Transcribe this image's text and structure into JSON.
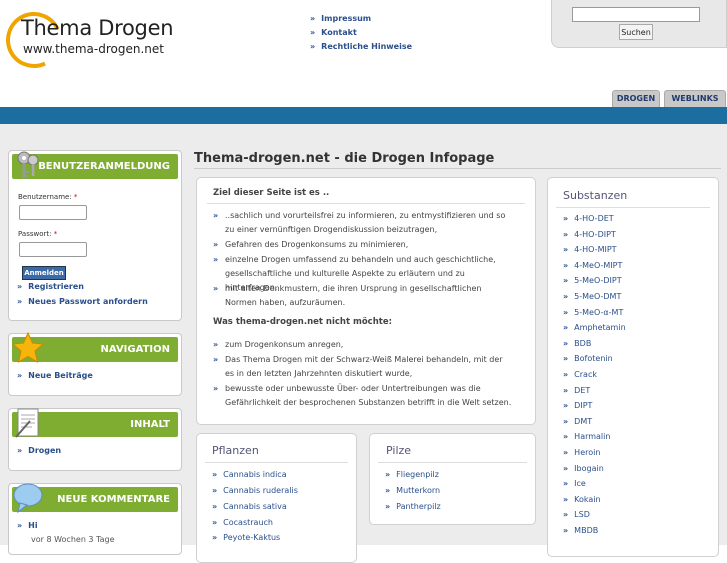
{
  "header": {
    "logo_title": "Thema Drogen",
    "logo_url": "www.thema-drogen.net",
    "top_links": [
      "Impressum",
      "Kontakt",
      "Rechtliche Hinweise"
    ],
    "search_button": "Suchen",
    "search_value": "",
    "tabs": [
      "DROGEN",
      "WEBLINKS"
    ]
  },
  "colors": {
    "accent_green": "#7fad32",
    "bar_blue": "#1c6ea0",
    "link_blue": "#2b4f8c"
  },
  "login": {
    "title": "BENUTZERANMELDUNG",
    "username_label": "Benutzername:",
    "password_label": "Passwort:",
    "required_mark": "*",
    "submit": "Anmelden",
    "register": "Registrieren",
    "forgot": "Neues Passwort anfordern"
  },
  "navigation": {
    "title": "NAVIGATION",
    "items": [
      "Neue Beiträge"
    ]
  },
  "inhalt": {
    "title": "INHALT",
    "items": [
      "Drogen"
    ]
  },
  "comments": {
    "title": "NEUE KOMMENTARE",
    "items": [
      {
        "title": "Hi",
        "meta": "vor 8 Wochen 3 Tage"
      }
    ]
  },
  "main": {
    "page_title": "Thema-drogen.net - die Drogen Infopage",
    "goal_heading": "Ziel dieser Seite ist es ..",
    "goals": [
      "..sachlich und vorurteilsfrei zu informieren, zu entmystifizieren und so zu einer vernünftigen Drogendiskussion beizutragen,",
      "Gefahren des Drogenkonsums zu minimieren,",
      "einzelne Drogen umfassend zu behandeln und auch geschichtliche, gesellschaftliche und kulturelle Aspekte zu erläutern und zu hinterfragen,",
      "mit alten Denkmustern, die ihren Ursprung in gesellschaftlichen Normen haben, aufzuräumen."
    ],
    "nogoal_heading": "Was thema-drogen.net nicht möchte:",
    "nogoals": [
      "zum Drogenkonsum anregen,",
      "Das Thema Drogen mit der Schwarz-Weiß Malerei behandeln, mit der es in den letzten Jahrzehnten diskutiert wurde,",
      "bewusste oder unbewusste Über- oder Untertreibungen was die Gefährlichkeit der besprochenen Substanzen betrifft in die Welt setzen."
    ]
  },
  "pflanzen": {
    "title": "Pflanzen",
    "items": [
      "Cannabis indica",
      "Cannabis ruderalis",
      "Cannabis sativa",
      "Cocastrauch",
      "Peyote-Kaktus"
    ]
  },
  "pilze": {
    "title": "Pilze",
    "items": [
      "Fliegenpilz",
      "Mutterkorn",
      "Pantherpilz"
    ]
  },
  "substanzen": {
    "title": "Substanzen",
    "items": [
      "4-HO-DET",
      "4-HO-DIPT",
      "4-HO-MIPT",
      "4-MeO-MIPT",
      "5-MeO-DIPT",
      "5-MeO-DMT",
      "5-MeO-α-MT",
      "Amphetamin",
      "BDB",
      "Bofotenin",
      "Crack",
      "DET",
      "DIPT",
      "DMT",
      "Harmalin",
      "Heroin",
      "Ibogain",
      "Ice",
      "Kokain",
      "LSD",
      "MBDB"
    ]
  }
}
